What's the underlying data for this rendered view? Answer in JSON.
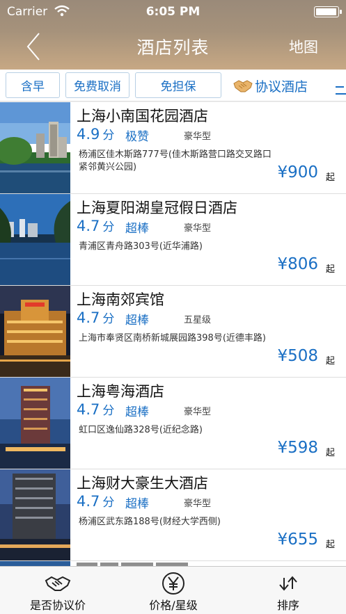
{
  "status_bar": {
    "carrier": "Carrier",
    "time": "6:05 PM"
  },
  "nav": {
    "title": "酒店列表",
    "right_action": "地图",
    "back_icon": "chevron-left-icon"
  },
  "filters": {
    "chips": [
      "含早",
      "免费取消",
      "免担保"
    ],
    "agreement_tab": "协议酒店"
  },
  "hotels": [
    {
      "name": "上海小南国花园酒店",
      "score": "4.9",
      "score_unit": "分",
      "rating": "极赞",
      "level": "豪华型",
      "address": "杨浦区佳木斯路777号(佳木斯路营口路交叉路口 紧邻黄兴公园)",
      "price": "¥900",
      "price_suffix": "起"
    },
    {
      "name": "上海夏阳湖皇冠假日酒店",
      "score": "4.7",
      "score_unit": "分",
      "rating": "超棒",
      "level": "豪华型",
      "address": "青浦区青舟路303号(近华浦路)",
      "price": "¥806",
      "price_suffix": "起"
    },
    {
      "name": "上海南郊宾馆",
      "score": "4.7",
      "score_unit": "分",
      "rating": "超棒",
      "level": "五星级",
      "address": "上海市奉贤区南桥新城展园路398号(近德丰路)",
      "price": "¥508",
      "price_suffix": "起"
    },
    {
      "name": "上海粤海酒店",
      "score": "4.7",
      "score_unit": "分",
      "rating": "超棒",
      "level": "豪华型",
      "address": "虹口区逸仙路328号(近纪念路)",
      "price": "¥598",
      "price_suffix": "起"
    },
    {
      "name": "上海财大豪生大酒店",
      "score": "4.7",
      "score_unit": "分",
      "rating": "超棒",
      "level": "豪华型",
      "address": "杨浦区武东路188号(财经大学西侧)",
      "price": "¥655",
      "price_suffix": "起"
    }
  ],
  "tab_bar": {
    "tabs": [
      {
        "label": "是否协议价",
        "icon": "handshake-icon"
      },
      {
        "label": "价格/星级",
        "icon": "yen-circle-icon"
      },
      {
        "label": "排序",
        "icon": "sort-arrows-icon"
      }
    ]
  },
  "colors": {
    "accent": "#1a6fc4",
    "header_top": "#9a8a79",
    "header_bottom": "#c7a884"
  }
}
